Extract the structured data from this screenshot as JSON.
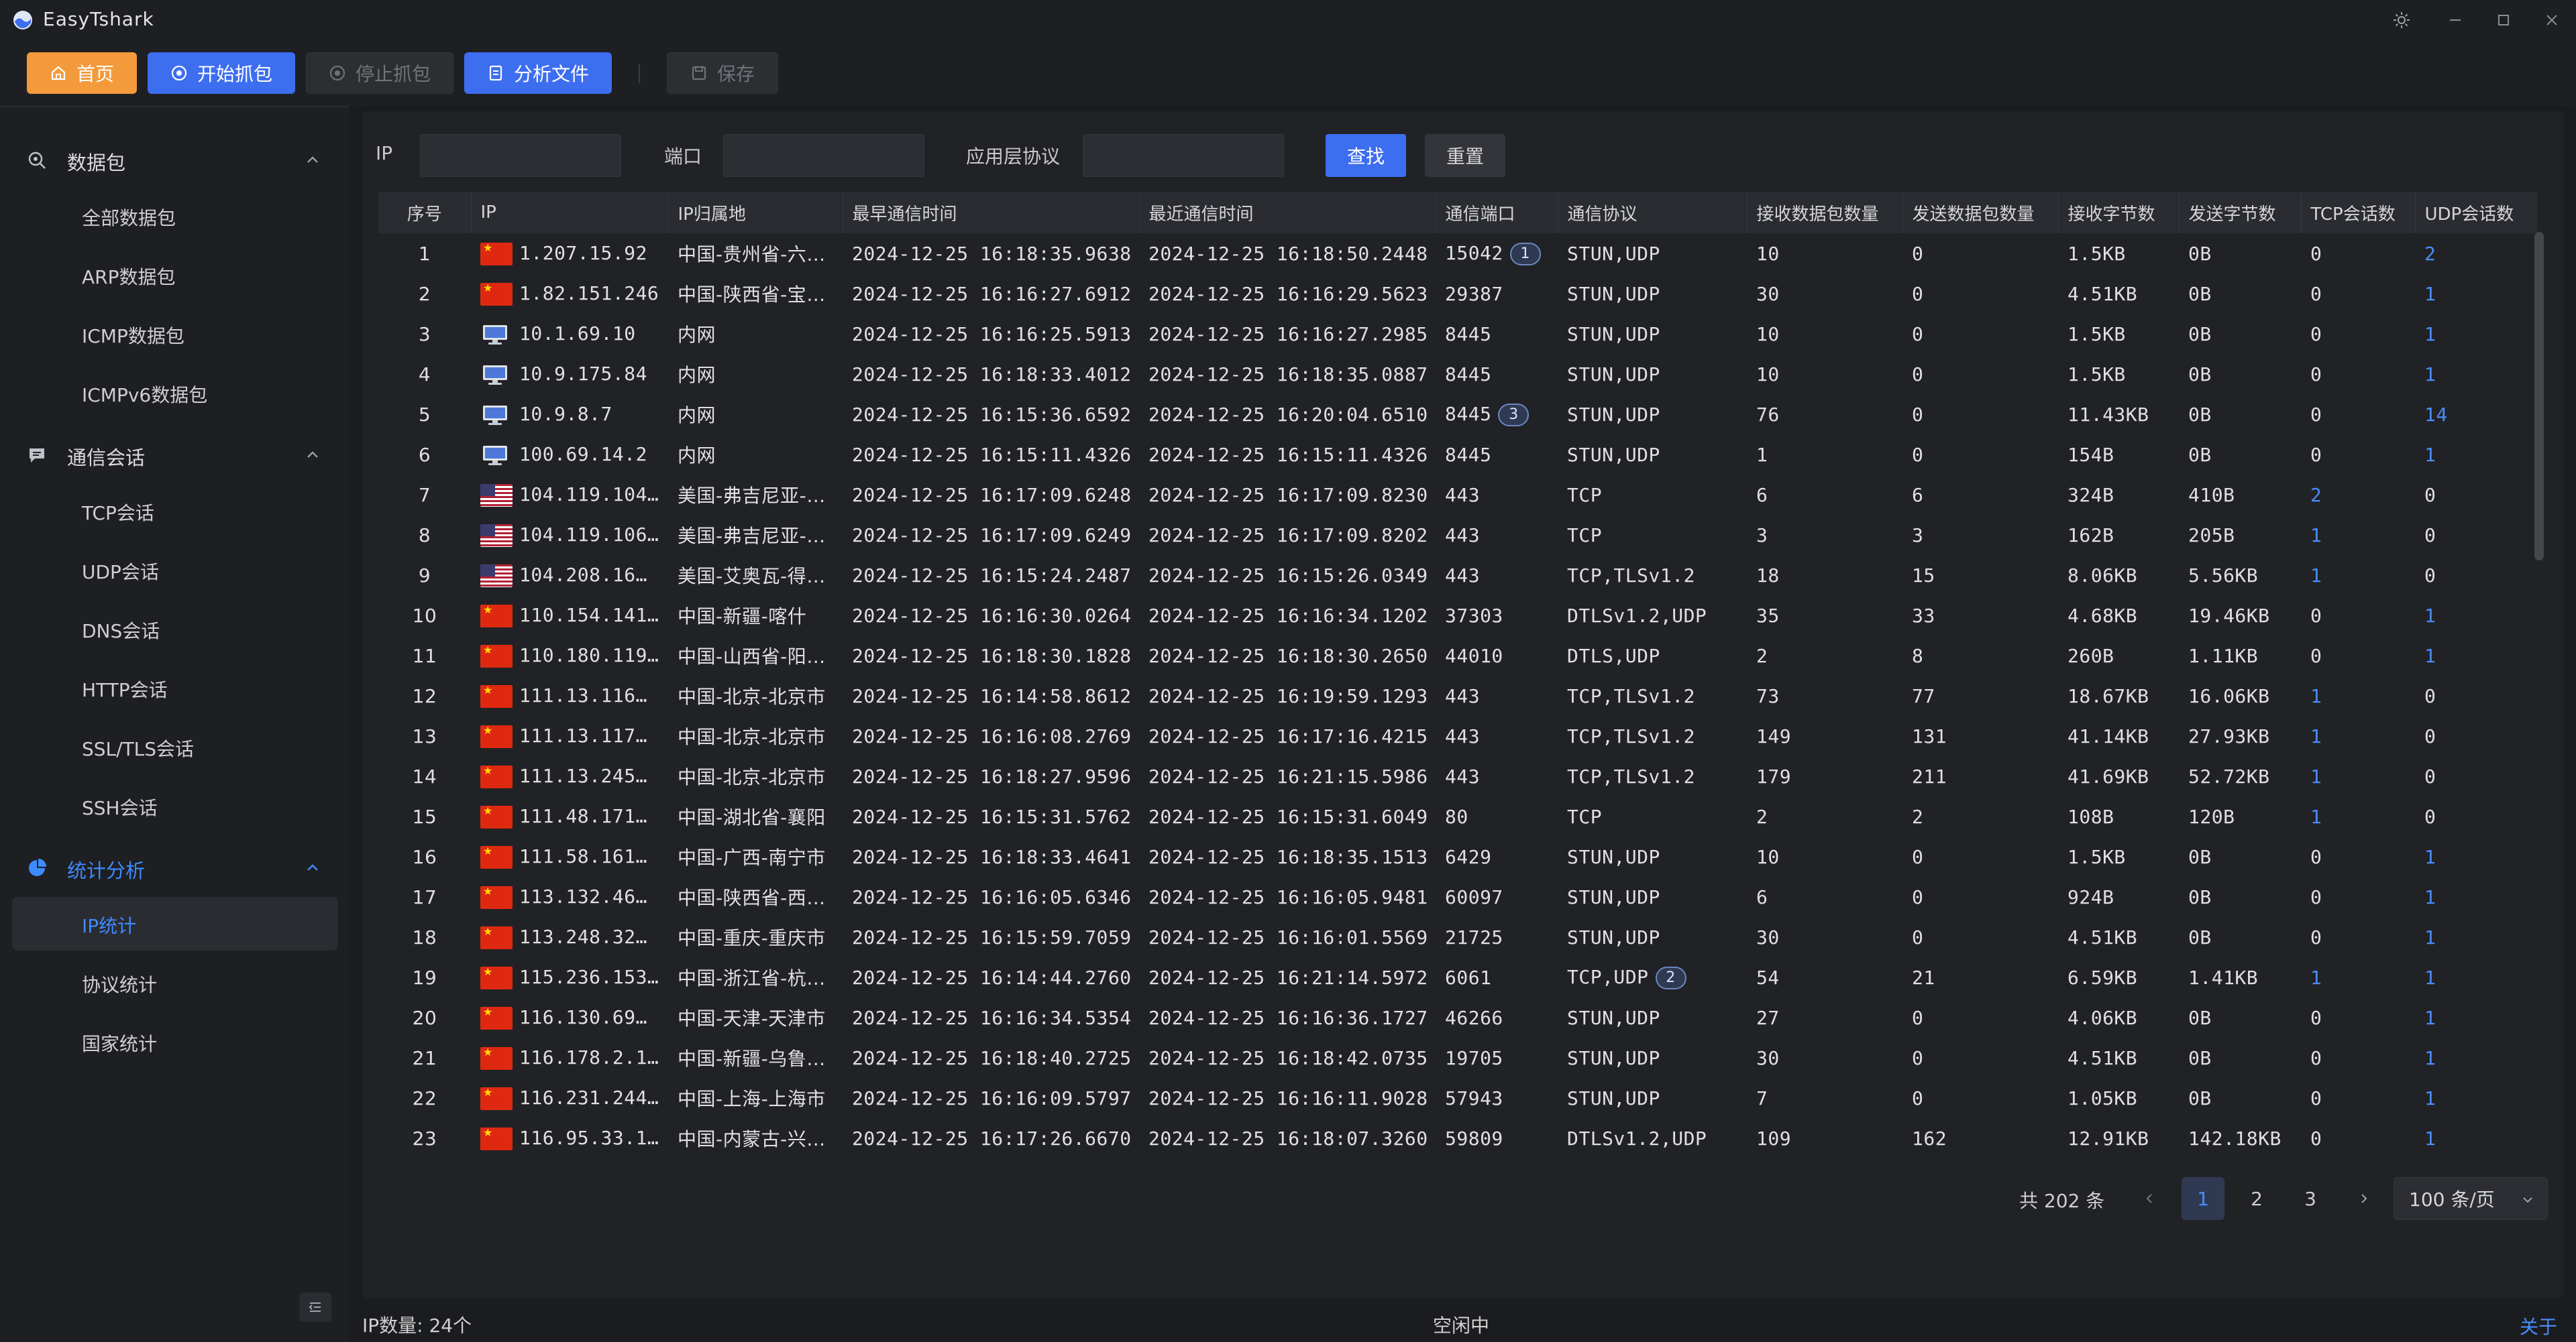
{
  "app": {
    "title": "EasyTshark"
  },
  "toolbar": {
    "home": "首页",
    "start_capture": "开始抓包",
    "stop_capture": "停止抓包",
    "analyze_file": "分析文件",
    "save": "保存"
  },
  "sidebar": {
    "groups": [
      {
        "label": "数据包",
        "items": [
          "全部数据包",
          "ARP数据包",
          "ICMP数据包",
          "ICMPv6数据包"
        ]
      },
      {
        "label": "通信会话",
        "items": [
          "TCP会话",
          "UDP会话",
          "DNS会话",
          "HTTP会话",
          "SSL/TLS会话",
          "SSH会话"
        ]
      },
      {
        "label": "统计分析",
        "items": [
          "IP统计",
          "协议统计",
          "国家统计"
        ]
      }
    ],
    "selected_item": "IP统计"
  },
  "filters": {
    "ip_label": "IP",
    "ip_value": "",
    "port_label": "端口",
    "port_value": "",
    "proto_label": "应用层协议",
    "proto_value": "",
    "search_button": "查找",
    "reset_button": "重置"
  },
  "table": {
    "columns": [
      "序号",
      "IP",
      "IP归属地",
      "最早通信时间",
      "最近通信时间",
      "通信端口",
      "通信协议",
      "接收数据包数量",
      "发送数据包数量",
      "接收字节数",
      "发送字节数",
      "TCP会话数",
      "UDP会话数"
    ],
    "rows": [
      {
        "no": "1",
        "flag": "cn",
        "ip": "1.207.15.92",
        "loc": "中国-贵州省-六…",
        "first": "2024-12-25 16:18:35.9638",
        "last": "2024-12-25 16:18:50.2448",
        "port": "15042",
        "port_badge": "1",
        "proto": "STUN,UDP",
        "proto_badge": "",
        "rx_pkts": "10",
        "tx_pkts": "0",
        "rx_bytes": "1.5KB",
        "tx_bytes": "0B",
        "tcp": "0",
        "udp": "2"
      },
      {
        "no": "2",
        "flag": "cn",
        "ip": "1.82.151.246",
        "loc": "中国-陕西省-宝…",
        "first": "2024-12-25 16:16:27.6912",
        "last": "2024-12-25 16:16:29.5623",
        "port": "29387",
        "port_badge": "",
        "proto": "STUN,UDP",
        "proto_badge": "",
        "rx_pkts": "30",
        "tx_pkts": "0",
        "rx_bytes": "4.51KB",
        "tx_bytes": "0B",
        "tcp": "0",
        "udp": "1"
      },
      {
        "no": "3",
        "flag": "lan",
        "ip": "10.1.69.10",
        "loc": "内网",
        "first": "2024-12-25 16:16:25.5913",
        "last": "2024-12-25 16:16:27.2985",
        "port": "8445",
        "port_badge": "",
        "proto": "STUN,UDP",
        "proto_badge": "",
        "rx_pkts": "10",
        "tx_pkts": "0",
        "rx_bytes": "1.5KB",
        "tx_bytes": "0B",
        "tcp": "0",
        "udp": "1"
      },
      {
        "no": "4",
        "flag": "lan",
        "ip": "10.9.175.84",
        "loc": "内网",
        "first": "2024-12-25 16:18:33.4012",
        "last": "2024-12-25 16:18:35.0887",
        "port": "8445",
        "port_badge": "",
        "proto": "STUN,UDP",
        "proto_badge": "",
        "rx_pkts": "10",
        "tx_pkts": "0",
        "rx_bytes": "1.5KB",
        "tx_bytes": "0B",
        "tcp": "0",
        "udp": "1"
      },
      {
        "no": "5",
        "flag": "lan",
        "ip": "10.9.8.7",
        "loc": "内网",
        "first": "2024-12-25 16:15:36.6592",
        "last": "2024-12-25 16:20:04.6510",
        "port": "8445",
        "port_badge": "3",
        "proto": "STUN,UDP",
        "proto_badge": "",
        "rx_pkts": "76",
        "tx_pkts": "0",
        "rx_bytes": "11.43KB",
        "tx_bytes": "0B",
        "tcp": "0",
        "udp": "14"
      },
      {
        "no": "6",
        "flag": "lan",
        "ip": "100.69.14.2",
        "loc": "内网",
        "first": "2024-12-25 16:15:11.4326",
        "last": "2024-12-25 16:15:11.4326",
        "port": "8445",
        "port_badge": "",
        "proto": "STUN,UDP",
        "proto_badge": "",
        "rx_pkts": "1",
        "tx_pkts": "0",
        "rx_bytes": "154B",
        "tx_bytes": "0B",
        "tcp": "0",
        "udp": "1"
      },
      {
        "no": "7",
        "flag": "us",
        "ip": "104.119.104…",
        "loc": "美国-弗吉尼亚-…",
        "first": "2024-12-25 16:17:09.6248",
        "last": "2024-12-25 16:17:09.8230",
        "port": "443",
        "port_badge": "",
        "proto": "TCP",
        "proto_badge": "",
        "rx_pkts": "6",
        "tx_pkts": "6",
        "rx_bytes": "324B",
        "tx_bytes": "410B",
        "tcp": "2",
        "udp": "0"
      },
      {
        "no": "8",
        "flag": "us",
        "ip": "104.119.106…",
        "loc": "美国-弗吉尼亚-…",
        "first": "2024-12-25 16:17:09.6249",
        "last": "2024-12-25 16:17:09.8202",
        "port": "443",
        "port_badge": "",
        "proto": "TCP",
        "proto_badge": "",
        "rx_pkts": "3",
        "tx_pkts": "3",
        "rx_bytes": "162B",
        "tx_bytes": "205B",
        "tcp": "1",
        "udp": "0"
      },
      {
        "no": "9",
        "flag": "us",
        "ip": "104.208.16…",
        "loc": "美国-艾奥瓦-得…",
        "first": "2024-12-25 16:15:24.2487",
        "last": "2024-12-25 16:15:26.0349",
        "port": "443",
        "port_badge": "",
        "proto": "TCP,TLSv1.2",
        "proto_badge": "",
        "rx_pkts": "18",
        "tx_pkts": "15",
        "rx_bytes": "8.06KB",
        "tx_bytes": "5.56KB",
        "tcp": "1",
        "udp": "0"
      },
      {
        "no": "10",
        "flag": "cn",
        "ip": "110.154.141…",
        "loc": "中国-新疆-喀什",
        "first": "2024-12-25 16:16:30.0264",
        "last": "2024-12-25 16:16:34.1202",
        "port": "37303",
        "port_badge": "",
        "proto": "DTLSv1.2,UDP",
        "proto_badge": "",
        "rx_pkts": "35",
        "tx_pkts": "33",
        "rx_bytes": "4.68KB",
        "tx_bytes": "19.46KB",
        "tcp": "0",
        "udp": "1"
      },
      {
        "no": "11",
        "flag": "cn",
        "ip": "110.180.119…",
        "loc": "中国-山西省-阳…",
        "first": "2024-12-25 16:18:30.1828",
        "last": "2024-12-25 16:18:30.2650",
        "port": "44010",
        "port_badge": "",
        "proto": "DTLS,UDP",
        "proto_badge": "",
        "rx_pkts": "2",
        "tx_pkts": "8",
        "rx_bytes": "260B",
        "tx_bytes": "1.11KB",
        "tcp": "0",
        "udp": "1"
      },
      {
        "no": "12",
        "flag": "cn",
        "ip": "111.13.116…",
        "loc": "中国-北京-北京市",
        "first": "2024-12-25 16:14:58.8612",
        "last": "2024-12-25 16:19:59.1293",
        "port": "443",
        "port_badge": "",
        "proto": "TCP,TLSv1.2",
        "proto_badge": "",
        "rx_pkts": "73",
        "tx_pkts": "77",
        "rx_bytes": "18.67KB",
        "tx_bytes": "16.06KB",
        "tcp": "1",
        "udp": "0"
      },
      {
        "no": "13",
        "flag": "cn",
        "ip": "111.13.117…",
        "loc": "中国-北京-北京市",
        "first": "2024-12-25 16:16:08.2769",
        "last": "2024-12-25 16:17:16.4215",
        "port": "443",
        "port_badge": "",
        "proto": "TCP,TLSv1.2",
        "proto_badge": "",
        "rx_pkts": "149",
        "tx_pkts": "131",
        "rx_bytes": "41.14KB",
        "tx_bytes": "27.93KB",
        "tcp": "1",
        "udp": "0"
      },
      {
        "no": "14",
        "flag": "cn",
        "ip": "111.13.245…",
        "loc": "中国-北京-北京市",
        "first": "2024-12-25 16:18:27.9596",
        "last": "2024-12-25 16:21:15.5986",
        "port": "443",
        "port_badge": "",
        "proto": "TCP,TLSv1.2",
        "proto_badge": "",
        "rx_pkts": "179",
        "tx_pkts": "211",
        "rx_bytes": "41.69KB",
        "tx_bytes": "52.72KB",
        "tcp": "1",
        "udp": "0"
      },
      {
        "no": "15",
        "flag": "cn",
        "ip": "111.48.171…",
        "loc": "中国-湖北省-襄阳",
        "first": "2024-12-25 16:15:31.5762",
        "last": "2024-12-25 16:15:31.6049",
        "port": "80",
        "port_badge": "",
        "proto": "TCP",
        "proto_badge": "",
        "rx_pkts": "2",
        "tx_pkts": "2",
        "rx_bytes": "108B",
        "tx_bytes": "120B",
        "tcp": "1",
        "udp": "0"
      },
      {
        "no": "16",
        "flag": "cn",
        "ip": "111.58.161…",
        "loc": "中国-广西-南宁市",
        "first": "2024-12-25 16:18:33.4641",
        "last": "2024-12-25 16:18:35.1513",
        "port": "6429",
        "port_badge": "",
        "proto": "STUN,UDP",
        "proto_badge": "",
        "rx_pkts": "10",
        "tx_pkts": "0",
        "rx_bytes": "1.5KB",
        "tx_bytes": "0B",
        "tcp": "0",
        "udp": "1"
      },
      {
        "no": "17",
        "flag": "cn",
        "ip": "113.132.46…",
        "loc": "中国-陕西省-西…",
        "first": "2024-12-25 16:16:05.6346",
        "last": "2024-12-25 16:16:05.9481",
        "port": "60097",
        "port_badge": "",
        "proto": "STUN,UDP",
        "proto_badge": "",
        "rx_pkts": "6",
        "tx_pkts": "0",
        "rx_bytes": "924B",
        "tx_bytes": "0B",
        "tcp": "0",
        "udp": "1"
      },
      {
        "no": "18",
        "flag": "cn",
        "ip": "113.248.32…",
        "loc": "中国-重庆-重庆市",
        "first": "2024-12-25 16:15:59.7059",
        "last": "2024-12-25 16:16:01.5569",
        "port": "21725",
        "port_badge": "",
        "proto": "STUN,UDP",
        "proto_badge": "",
        "rx_pkts": "30",
        "tx_pkts": "0",
        "rx_bytes": "4.51KB",
        "tx_bytes": "0B",
        "tcp": "0",
        "udp": "1"
      },
      {
        "no": "19",
        "flag": "cn",
        "ip": "115.236.153…",
        "loc": "中国-浙江省-杭…",
        "first": "2024-12-25 16:14:44.2760",
        "last": "2024-12-25 16:21:14.5972",
        "port": "6061",
        "port_badge": "",
        "proto": "TCP,UDP",
        "proto_badge": "2",
        "rx_pkts": "54",
        "tx_pkts": "21",
        "rx_bytes": "6.59KB",
        "tx_bytes": "1.41KB",
        "tcp": "1",
        "udp": "1"
      },
      {
        "no": "20",
        "flag": "cn",
        "ip": "116.130.69…",
        "loc": "中国-天津-天津市",
        "first": "2024-12-25 16:16:34.5354",
        "last": "2024-12-25 16:16:36.1727",
        "port": "46266",
        "port_badge": "",
        "proto": "STUN,UDP",
        "proto_badge": "",
        "rx_pkts": "27",
        "tx_pkts": "0",
        "rx_bytes": "4.06KB",
        "tx_bytes": "0B",
        "tcp": "0",
        "udp": "1"
      },
      {
        "no": "21",
        "flag": "cn",
        "ip": "116.178.2.1…",
        "loc": "中国-新疆-乌鲁…",
        "first": "2024-12-25 16:18:40.2725",
        "last": "2024-12-25 16:18:42.0735",
        "port": "19705",
        "port_badge": "",
        "proto": "STUN,UDP",
        "proto_badge": "",
        "rx_pkts": "30",
        "tx_pkts": "0",
        "rx_bytes": "4.51KB",
        "tx_bytes": "0B",
        "tcp": "0",
        "udp": "1"
      },
      {
        "no": "22",
        "flag": "cn",
        "ip": "116.231.244…",
        "loc": "中国-上海-上海市",
        "first": "2024-12-25 16:16:09.5797",
        "last": "2024-12-25 16:16:11.9028",
        "port": "57943",
        "port_badge": "",
        "proto": "STUN,UDP",
        "proto_badge": "",
        "rx_pkts": "7",
        "tx_pkts": "0",
        "rx_bytes": "1.05KB",
        "tx_bytes": "0B",
        "tcp": "0",
        "udp": "1"
      },
      {
        "no": "23",
        "flag": "cn",
        "ip": "116.95.33.1…",
        "loc": "中国-内蒙古-兴…",
        "first": "2024-12-25 16:17:26.6670",
        "last": "2024-12-25 16:18:07.3260",
        "port": "59809",
        "port_badge": "",
        "proto": "DTLSv1.2,UDP",
        "proto_badge": "",
        "rx_pkts": "109",
        "tx_pkts": "162",
        "rx_bytes": "12.91KB",
        "tx_bytes": "142.18KB",
        "tcp": "0",
        "udp": "1"
      }
    ]
  },
  "pagination": {
    "total_text": "共 202 条",
    "pages": [
      "1",
      "2",
      "3"
    ],
    "current": "1",
    "page_size": "100 条/页"
  },
  "status": {
    "ip_count": "IP数量: 24个",
    "state": "空闲中",
    "about": "关于"
  },
  "colors": {
    "accent_blue": "#3d6ef0",
    "home_orange": "#f39a3c",
    "link_blue": "#4a8cff"
  }
}
